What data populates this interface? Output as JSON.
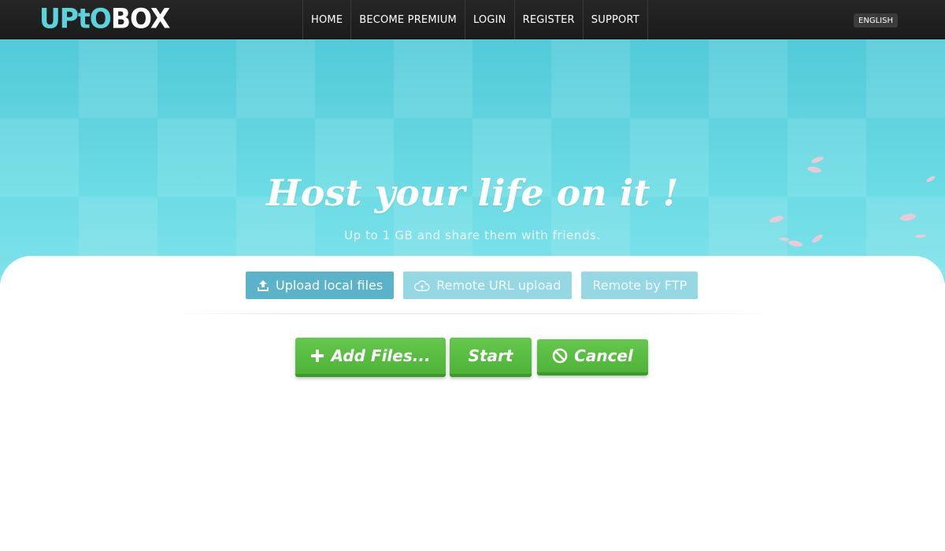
{
  "header": {
    "logo_part1": "UPtO",
    "logo_part2": "BOX",
    "nav": [
      {
        "label": "HOME"
      },
      {
        "label": "BECOME PREMIUM"
      },
      {
        "label": "LOGIN"
      },
      {
        "label": "REGISTER"
      },
      {
        "label": "SUPPORT"
      }
    ],
    "language": "ENGLISH"
  },
  "hero": {
    "title": "Host your life on it !",
    "subtitle": "Up to 1 GB and share them with friends."
  },
  "upload": {
    "tabs": [
      {
        "label": "Upload local files",
        "icon": "upload-icon",
        "active": true
      },
      {
        "label": "Remote URL upload",
        "icon": "cloud-icon",
        "active": false
      },
      {
        "label": "Remote by FTP",
        "icon": "",
        "active": false
      }
    ],
    "add_label": "Add Files...",
    "start_label": "Start",
    "cancel_label": "Cancel"
  },
  "colors": {
    "accent_teal": "#5cd3dc",
    "tab_active": "#5ab3c8",
    "tab_inactive": "#95d7e2",
    "button_green": "#5bbf44"
  }
}
